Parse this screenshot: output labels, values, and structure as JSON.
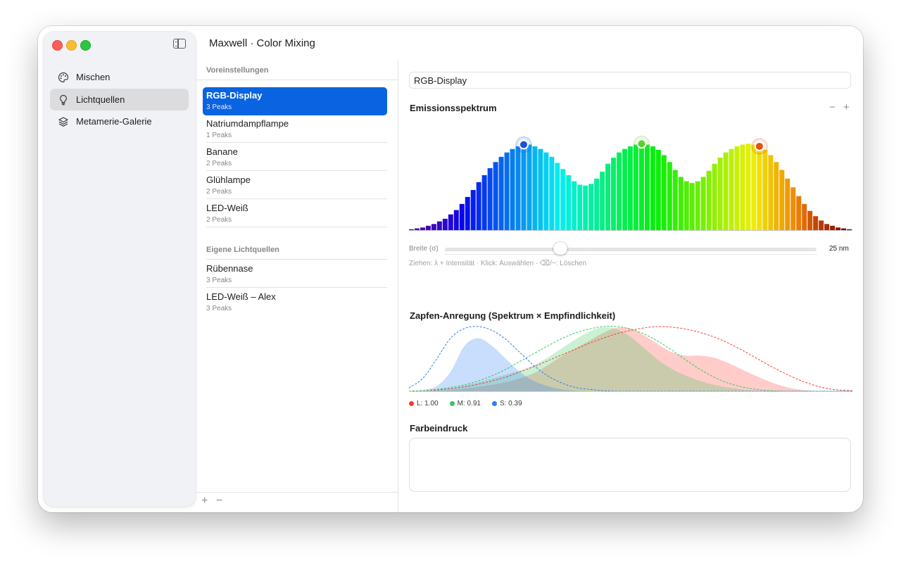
{
  "window": {
    "title": "Maxwell · Color Mixing"
  },
  "sidebar": {
    "items": [
      {
        "label": "Mischen",
        "icon": "palette-icon",
        "active": false
      },
      {
        "label": "Lichtquellen",
        "icon": "lightbulb-icon",
        "active": true
      },
      {
        "label": "Metamerie-Galerie",
        "icon": "layers-icon",
        "active": false
      }
    ]
  },
  "list": {
    "presets_header": "Voreinstellungen",
    "presets": [
      {
        "name": "RGB-Display",
        "sub": "3 Peaks",
        "selected": true
      },
      {
        "name": "Natriumdampflampe",
        "sub": "1 Peaks"
      },
      {
        "name": "Banane",
        "sub": "2 Peaks"
      },
      {
        "name": "Glühlampe",
        "sub": "2 Peaks"
      },
      {
        "name": "LED-Weiß",
        "sub": "2 Peaks"
      }
    ],
    "custom_header": "Eigene Lichtquellen",
    "custom": [
      {
        "name": "Rübennase",
        "sub": "3 Peaks"
      },
      {
        "name": "LED-Weiß – Alex",
        "sub": "3 Peaks"
      }
    ],
    "add_label": "+",
    "remove_label": "−"
  },
  "detail": {
    "name_value": "RGB-Display",
    "emission_title": "Emissionsspektrum",
    "zoom_out_label": "−",
    "zoom_in_label": "+",
    "width_label": "Breite (σ)",
    "width_value": "25 nm",
    "width_fraction": 0.31,
    "hint": "Ziehen: λ + Intensität · Klick: Auswählen · ⌫/−: Löschen",
    "cone_title": "Zapfen-Anregung (Spektrum × Empfindlichkeit)",
    "legend": [
      {
        "label": "L: 1.00",
        "color": "#ff3b30"
      },
      {
        "label": "M: 0.91",
        "color": "#34c759"
      },
      {
        "label": "S: 0.39",
        "color": "#2f7cf6"
      }
    ],
    "color_title": "Farbeindruck"
  },
  "chart_data": [
    {
      "type": "bar",
      "title": "Emissionsspektrum",
      "peaks": [
        {
          "color": "#1e4fe0",
          "bar_index": 20
        },
        {
          "color": "#5cd02a",
          "bar_index": 41
        },
        {
          "color": "#e2500e",
          "bar_index": 62
        }
      ],
      "values": [
        0.01,
        0.02,
        0.03,
        0.05,
        0.07,
        0.1,
        0.13,
        0.18,
        0.23,
        0.3,
        0.38,
        0.46,
        0.55,
        0.63,
        0.71,
        0.78,
        0.84,
        0.89,
        0.93,
        0.96,
        0.98,
        0.98,
        0.96,
        0.93,
        0.89,
        0.84,
        0.77,
        0.7,
        0.63,
        0.56,
        0.52,
        0.51,
        0.53,
        0.59,
        0.67,
        0.76,
        0.83,
        0.89,
        0.93,
        0.96,
        0.98,
        0.99,
        0.98,
        0.96,
        0.92,
        0.86,
        0.78,
        0.69,
        0.61,
        0.56,
        0.54,
        0.56,
        0.61,
        0.68,
        0.76,
        0.83,
        0.89,
        0.93,
        0.96,
        0.98,
        0.99,
        0.98,
        0.96,
        0.92,
        0.86,
        0.78,
        0.69,
        0.59,
        0.49,
        0.39,
        0.3,
        0.22,
        0.16,
        0.11,
        0.07,
        0.05,
        0.03,
        0.02,
        0.01
      ]
    },
    {
      "type": "area",
      "title": "Zapfen-Anregung (Spektrum × Empfindlichkeit)",
      "series": [
        {
          "name": "L",
          "color": "#ff3b30",
          "sensitivity": [
            0,
            0.01,
            0.02,
            0.04,
            0.07,
            0.11,
            0.16,
            0.22,
            0.3,
            0.38,
            0.47,
            0.56,
            0.65,
            0.74,
            0.82,
            0.89,
            0.94,
            0.98,
            1.0,
            0.99,
            0.96,
            0.91,
            0.84,
            0.75,
            0.64,
            0.52,
            0.4,
            0.29,
            0.19,
            0.11,
            0.05,
            0.02,
            0.01
          ],
          "response": [
            0,
            0,
            0.01,
            0.02,
            0.04,
            0.07,
            0.1,
            0.14,
            0.2,
            0.28,
            0.4,
            0.54,
            0.66,
            0.78,
            0.9,
            0.98,
            0.97,
            0.86,
            0.72,
            0.6,
            0.55,
            0.55,
            0.52,
            0.44,
            0.34,
            0.24,
            0.15,
            0.08,
            0.03,
            0.01,
            0,
            0,
            0
          ]
        },
        {
          "name": "M",
          "color": "#34c759",
          "sensitivity": [
            0,
            0.01,
            0.03,
            0.06,
            0.1,
            0.16,
            0.24,
            0.34,
            0.46,
            0.58,
            0.7,
            0.81,
            0.9,
            0.96,
            1.0,
            1.0,
            0.96,
            0.88,
            0.77,
            0.63,
            0.48,
            0.34,
            0.22,
            0.13,
            0.07,
            0.03,
            0.01,
            0,
            0,
            0,
            0,
            0,
            0
          ],
          "response": [
            0,
            0,
            0.02,
            0.05,
            0.09,
            0.14,
            0.2,
            0.26,
            0.32,
            0.4,
            0.52,
            0.66,
            0.8,
            0.92,
            0.99,
            0.96,
            0.84,
            0.66,
            0.48,
            0.34,
            0.24,
            0.16,
            0.1,
            0.06,
            0.03,
            0.01,
            0,
            0,
            0,
            0,
            0,
            0,
            0
          ]
        },
        {
          "name": "S",
          "color": "#2f7cf6",
          "sensitivity": [
            0.05,
            0.2,
            0.5,
            0.82,
            0.97,
            1.0,
            0.94,
            0.8,
            0.6,
            0.4,
            0.24,
            0.13,
            0.06,
            0.03,
            0.01,
            0,
            0,
            0,
            0,
            0,
            0,
            0,
            0,
            0,
            0,
            0,
            0,
            0,
            0,
            0,
            0,
            0,
            0
          ],
          "response": [
            0,
            0.02,
            0.08,
            0.3,
            0.7,
            0.82,
            0.7,
            0.5,
            0.3,
            0.16,
            0.08,
            0.03,
            0.01,
            0,
            0,
            0,
            0,
            0,
            0,
            0,
            0,
            0,
            0,
            0,
            0,
            0,
            0,
            0,
            0,
            0,
            0,
            0,
            0
          ]
        }
      ]
    }
  ]
}
